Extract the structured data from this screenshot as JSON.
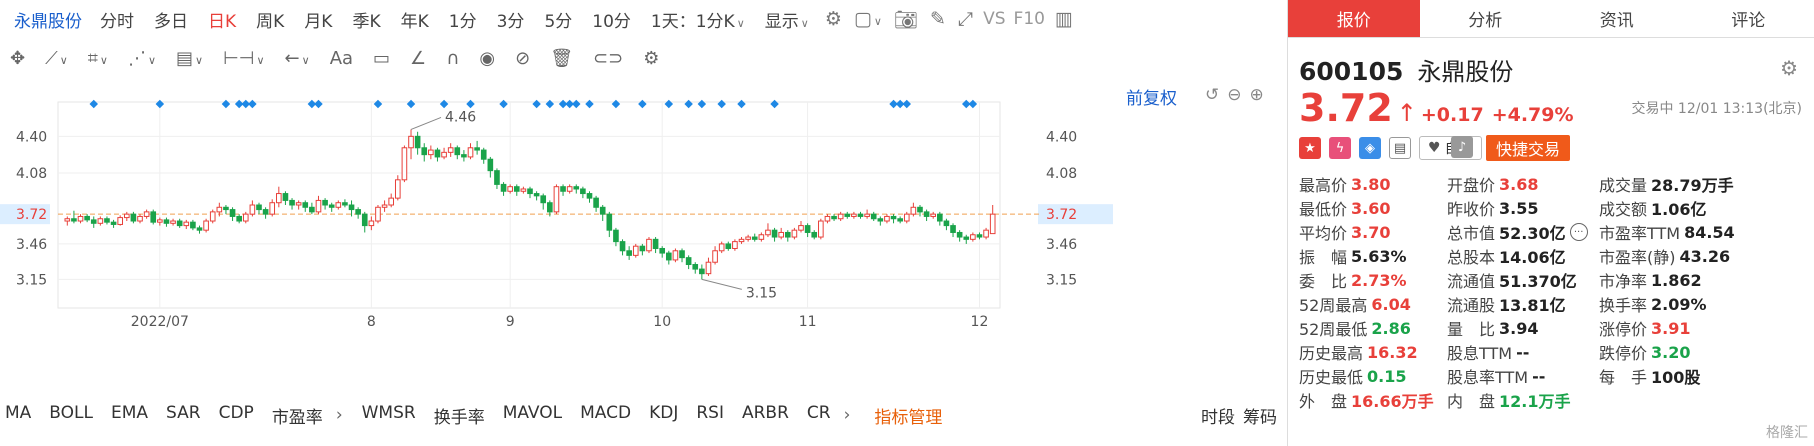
{
  "toolbar": {
    "stock_name": "永鼎股份",
    "periods": [
      {
        "label": "分时",
        "active": false
      },
      {
        "label": "多日",
        "active": false
      },
      {
        "label": "日K",
        "active": true
      },
      {
        "label": "周K",
        "active": false
      },
      {
        "label": "月K",
        "active": false
      },
      {
        "label": "季K",
        "active": false
      },
      {
        "label": "年K",
        "active": false
      },
      {
        "label": "1分",
        "active": false
      },
      {
        "label": "3分",
        "active": false
      },
      {
        "label": "5分",
        "active": false
      },
      {
        "label": "10分",
        "active": false
      }
    ],
    "interval_select": "1天：1分K",
    "display_label": "显示",
    "vs_label": "VS",
    "f10_label": "F10",
    "icons": [
      "gear-icon",
      "square-icon",
      "camera-icon",
      "pen-icon",
      "fullscreen-icon",
      "panel-icon"
    ]
  },
  "draw_tools": {
    "icons": [
      "move-icon",
      "line-icon",
      "ray-icon",
      "polyline-icon",
      "fib-icon",
      "range-icon",
      "arrow-icon",
      "text-icon",
      "comment-icon",
      "ruler-icon",
      "magnet-icon",
      "eye-icon",
      "hide-icon",
      "trash-icon",
      "link-icon",
      "settings-icon"
    ],
    "text_tool_label": "Aa"
  },
  "chart_controls": {
    "adjust_label": "前复权"
  },
  "indicators": {
    "items": [
      "MA",
      "BOLL",
      "EMA",
      "SAR",
      "CDP",
      "市盈率",
      "WMSR",
      "换手率",
      "MAVOL",
      "MACD",
      "KDJ",
      "RSI",
      "ARBR",
      "CR"
    ],
    "manage_label": "指标管理",
    "right_items": [
      "时段",
      "筹码"
    ]
  },
  "chart_data": {
    "type": "candlestick",
    "y_ticks": [
      4.4,
      4.08,
      3.72,
      3.46,
      3.15
    ],
    "x_ticks": [
      "2022/07",
      "8",
      "9",
      "10",
      "11",
      "12"
    ],
    "current_price_label": "3.72",
    "high_annotation": "4.46",
    "low_annotation": "3.15",
    "ylim": [
      2.9,
      4.7
    ],
    "colors": {
      "up": "#e8403a",
      "down": "#1aa34a",
      "current_line": "#f0a050",
      "marker": "#1e88e5"
    },
    "candles": [
      [
        3.66,
        3.68,
        3.62,
        3.7
      ],
      [
        3.68,
        3.66,
        3.64,
        3.75
      ],
      [
        3.66,
        3.7,
        3.64,
        3.72
      ],
      [
        3.7,
        3.67,
        3.65,
        3.72
      ],
      [
        3.67,
        3.64,
        3.6,
        3.7
      ],
      [
        3.64,
        3.68,
        3.62,
        3.7
      ],
      [
        3.68,
        3.65,
        3.63,
        3.7
      ],
      [
        3.65,
        3.63,
        3.6,
        3.67
      ],
      [
        3.63,
        3.69,
        3.62,
        3.71
      ],
      [
        3.69,
        3.72,
        3.66,
        3.74
      ],
      [
        3.72,
        3.66,
        3.64,
        3.74
      ],
      [
        3.66,
        3.7,
        3.64,
        3.72
      ],
      [
        3.7,
        3.74,
        3.68,
        3.76
      ],
      [
        3.74,
        3.65,
        3.63,
        3.76
      ],
      [
        3.65,
        3.67,
        3.62,
        3.69
      ],
      [
        3.67,
        3.64,
        3.61,
        3.69
      ],
      [
        3.64,
        3.66,
        3.62,
        3.68
      ],
      [
        3.66,
        3.62,
        3.6,
        3.68
      ],
      [
        3.62,
        3.65,
        3.59,
        3.67
      ],
      [
        3.65,
        3.6,
        3.58,
        3.67
      ],
      [
        3.6,
        3.58,
        3.55,
        3.62
      ],
      [
        3.58,
        3.66,
        3.56,
        3.68
      ],
      [
        3.66,
        3.74,
        3.64,
        3.76
      ],
      [
        3.74,
        3.78,
        3.7,
        3.82
      ],
      [
        3.78,
        3.76,
        3.72,
        3.8
      ],
      [
        3.76,
        3.7,
        3.66,
        3.78
      ],
      [
        3.7,
        3.66,
        3.64,
        3.72
      ],
      [
        3.66,
        3.72,
        3.64,
        3.74
      ],
      [
        3.72,
        3.8,
        3.7,
        3.84
      ],
      [
        3.8,
        3.76,
        3.72,
        3.82
      ],
      [
        3.76,
        3.72,
        3.68,
        3.78
      ],
      [
        3.72,
        3.82,
        3.7,
        3.85
      ],
      [
        3.82,
        3.9,
        3.78,
        3.96
      ],
      [
        3.9,
        3.84,
        3.8,
        3.92
      ],
      [
        3.84,
        3.8,
        3.76,
        3.86
      ],
      [
        3.8,
        3.82,
        3.76,
        3.84
      ],
      [
        3.82,
        3.78,
        3.74,
        3.84
      ],
      [
        3.78,
        3.74,
        3.72,
        3.82
      ],
      [
        3.74,
        3.84,
        3.72,
        3.88
      ],
      [
        3.84,
        3.8,
        3.76,
        3.86
      ],
      [
        3.8,
        3.78,
        3.74,
        3.82
      ],
      [
        3.78,
        3.82,
        3.76,
        3.84
      ],
      [
        3.82,
        3.8,
        3.78,
        3.85
      ],
      [
        3.8,
        3.76,
        3.7,
        3.84
      ],
      [
        3.76,
        3.72,
        3.68,
        3.78
      ],
      [
        3.72,
        3.62,
        3.56,
        3.74
      ],
      [
        3.62,
        3.66,
        3.58,
        3.7
      ],
      [
        3.66,
        3.78,
        3.64,
        3.8
      ],
      [
        3.78,
        3.8,
        3.74,
        3.84
      ],
      [
        3.8,
        3.86,
        3.78,
        3.9
      ],
      [
        3.86,
        4.02,
        3.84,
        4.06
      ],
      [
        4.02,
        4.3,
        4.0,
        4.32
      ],
      [
        4.3,
        4.4,
        4.2,
        4.46
      ],
      [
        4.4,
        4.3,
        4.24,
        4.44
      ],
      [
        4.3,
        4.24,
        4.18,
        4.34
      ],
      [
        4.24,
        4.28,
        4.2,
        4.32
      ],
      [
        4.28,
        4.22,
        4.18,
        4.3
      ],
      [
        4.22,
        4.26,
        4.2,
        4.3
      ],
      [
        4.26,
        4.3,
        4.22,
        4.34
      ],
      [
        4.3,
        4.24,
        4.2,
        4.32
      ],
      [
        4.24,
        4.22,
        4.18,
        4.28
      ],
      [
        4.22,
        4.3,
        4.2,
        4.34
      ],
      [
        4.3,
        4.28,
        4.24,
        4.36
      ],
      [
        4.28,
        4.2,
        4.16,
        4.3
      ],
      [
        4.2,
        4.1,
        4.04,
        4.22
      ],
      [
        4.1,
        3.98,
        3.94,
        4.12
      ],
      [
        3.98,
        3.92,
        3.88,
        4.0
      ],
      [
        3.92,
        3.96,
        3.9,
        3.98
      ],
      [
        3.96,
        3.92,
        3.88,
        3.98
      ],
      [
        3.92,
        3.94,
        3.9,
        3.96
      ],
      [
        3.94,
        3.9,
        3.86,
        3.96
      ],
      [
        3.9,
        3.88,
        3.84,
        3.92
      ],
      [
        3.88,
        3.82,
        3.76,
        3.9
      ],
      [
        3.82,
        3.74,
        3.7,
        3.84
      ],
      [
        3.74,
        3.96,
        3.72,
        3.98
      ],
      [
        3.96,
        3.92,
        3.88,
        3.98
      ],
      [
        3.92,
        3.96,
        3.9,
        3.98
      ],
      [
        3.96,
        3.94,
        3.9,
        3.98
      ],
      [
        3.94,
        3.9,
        3.86,
        3.96
      ],
      [
        3.9,
        3.86,
        3.82,
        3.92
      ],
      [
        3.86,
        3.78,
        3.74,
        3.88
      ],
      [
        3.78,
        3.72,
        3.66,
        3.8
      ],
      [
        3.72,
        3.58,
        3.52,
        3.74
      ],
      [
        3.58,
        3.48,
        3.44,
        3.6
      ],
      [
        3.48,
        3.4,
        3.36,
        3.5
      ],
      [
        3.4,
        3.36,
        3.32,
        3.44
      ],
      [
        3.36,
        3.44,
        3.34,
        3.46
      ],
      [
        3.44,
        3.4,
        3.36,
        3.46
      ],
      [
        3.4,
        3.5,
        3.38,
        3.52
      ],
      [
        3.5,
        3.42,
        3.38,
        3.52
      ],
      [
        3.42,
        3.38,
        3.34,
        3.44
      ],
      [
        3.38,
        3.32,
        3.28,
        3.4
      ],
      [
        3.32,
        3.4,
        3.3,
        3.42
      ],
      [
        3.4,
        3.34,
        3.3,
        3.42
      ],
      [
        3.34,
        3.28,
        3.24,
        3.36
      ],
      [
        3.28,
        3.24,
        3.2,
        3.3
      ],
      [
        3.24,
        3.2,
        3.15,
        3.28
      ],
      [
        3.2,
        3.3,
        3.18,
        3.34
      ],
      [
        3.3,
        3.4,
        3.28,
        3.44
      ],
      [
        3.4,
        3.46,
        3.38,
        3.48
      ],
      [
        3.46,
        3.42,
        3.4,
        3.48
      ],
      [
        3.42,
        3.48,
        3.4,
        3.5
      ],
      [
        3.48,
        3.5,
        3.46,
        3.52
      ],
      [
        3.5,
        3.52,
        3.48,
        3.54
      ],
      [
        3.52,
        3.5,
        3.48,
        3.55
      ],
      [
        3.5,
        3.54,
        3.48,
        3.56
      ],
      [
        3.54,
        3.58,
        3.52,
        3.64
      ],
      [
        3.58,
        3.52,
        3.48,
        3.6
      ],
      [
        3.52,
        3.56,
        3.5,
        3.6
      ],
      [
        3.56,
        3.52,
        3.48,
        3.58
      ],
      [
        3.52,
        3.58,
        3.5,
        3.6
      ],
      [
        3.58,
        3.62,
        3.56,
        3.66
      ],
      [
        3.62,
        3.56,
        3.52,
        3.64
      ],
      [
        3.56,
        3.52,
        3.5,
        3.58
      ],
      [
        3.52,
        3.66,
        3.5,
        3.68
      ],
      [
        3.66,
        3.7,
        3.64,
        3.72
      ],
      [
        3.7,
        3.68,
        3.66,
        3.72
      ],
      [
        3.68,
        3.72,
        3.66,
        3.74
      ],
      [
        3.72,
        3.7,
        3.68,
        3.74
      ],
      [
        3.7,
        3.72,
        3.68,
        3.74
      ],
      [
        3.72,
        3.7,
        3.68,
        3.74
      ],
      [
        3.7,
        3.72,
        3.68,
        3.76
      ],
      [
        3.72,
        3.68,
        3.66,
        3.74
      ],
      [
        3.68,
        3.66,
        3.62,
        3.7
      ],
      [
        3.66,
        3.7,
        3.64,
        3.72
      ],
      [
        3.7,
        3.68,
        3.64,
        3.72
      ],
      [
        3.68,
        3.66,
        3.64,
        3.7
      ],
      [
        3.66,
        3.72,
        3.64,
        3.74
      ],
      [
        3.72,
        3.78,
        3.7,
        3.82
      ],
      [
        3.78,
        3.74,
        3.7,
        3.8
      ],
      [
        3.74,
        3.7,
        3.66,
        3.76
      ],
      [
        3.7,
        3.72,
        3.68,
        3.74
      ],
      [
        3.72,
        3.66,
        3.62,
        3.74
      ],
      [
        3.66,
        3.62,
        3.58,
        3.68
      ],
      [
        3.62,
        3.56,
        3.52,
        3.64
      ],
      [
        3.56,
        3.52,
        3.48,
        3.58
      ],
      [
        3.52,
        3.5,
        3.46,
        3.54
      ],
      [
        3.5,
        3.54,
        3.48,
        3.56
      ],
      [
        3.54,
        3.52,
        3.5,
        3.56
      ],
      [
        3.52,
        3.58,
        3.5,
        3.6
      ],
      [
        3.55,
        3.72,
        3.6,
        3.8
      ]
    ],
    "markers_at": [
      3,
      10,
      18,
      19,
      20,
      21,
      27,
      28,
      35,
      38,
      42,
      45,
      49,
      52,
      54,
      55,
      56,
      57,
      58,
      61,
      64,
      67,
      69,
      71,
      73,
      75,
      79,
      92,
      93,
      94,
      100,
      101
    ]
  },
  "quote": {
    "tabs": [
      {
        "label": "报价",
        "active": true
      },
      {
        "label": "分析",
        "active": false
      },
      {
        "label": "资讯",
        "active": false
      },
      {
        "label": "评论",
        "active": false
      }
    ],
    "code": "600105",
    "name": "永鼎股份",
    "price": "3.72",
    "arrow": "↑",
    "change": "+0.17",
    "change_pct": "+4.79%",
    "status": "交易中 12/01 13:13(北京)",
    "watch_label": "自选",
    "trade_label": "快捷交易",
    "rows": [
      [
        {
          "l": "最高价",
          "v": "3.80",
          "c": "red"
        },
        {
          "l": "开盘价",
          "v": "3.68",
          "c": "red"
        },
        {
          "l": "成交量",
          "v": "28.79万手",
          "c": "dark"
        }
      ],
      [
        {
          "l": "最低价",
          "v": "3.60",
          "c": "red"
        },
        {
          "l": "昨收价",
          "v": "3.55",
          "c": "dark"
        },
        {
          "l": "成交额",
          "v": "1.06亿",
          "c": "dark"
        }
      ],
      [
        {
          "l": "平均价",
          "v": "3.70",
          "c": "red"
        },
        {
          "l": "总市值",
          "v": "52.30亿",
          "c": "dark"
        },
        {
          "l": "市盈率TTM",
          "v": "84.54",
          "c": "dark"
        }
      ],
      [
        {
          "l": "振　幅",
          "v": "5.63%",
          "c": "dark"
        },
        {
          "l": "总股本",
          "v": "14.06亿",
          "c": "dark"
        },
        {
          "l": "市盈率(静)",
          "v": "43.26",
          "c": "dark"
        }
      ],
      [
        {
          "l": "委　比",
          "v": "2.73%",
          "c": "red"
        },
        {
          "l": "流通值",
          "v": "51.370亿",
          "c": "dark"
        },
        {
          "l": "市净率",
          "v": "1.862",
          "c": "dark"
        }
      ],
      [
        {
          "l": "52周最高",
          "v": "6.04",
          "c": "red"
        },
        {
          "l": "流通股",
          "v": "13.81亿",
          "c": "dark"
        },
        {
          "l": "换手率",
          "v": "2.09%",
          "c": "dark"
        }
      ],
      [
        {
          "l": "52周最低",
          "v": "2.86",
          "c": "green"
        },
        {
          "l": "量　比",
          "v": "3.94",
          "c": "dark"
        },
        {
          "l": "涨停价",
          "v": "3.91",
          "c": "red"
        }
      ],
      [
        {
          "l": "历史最高",
          "v": "16.32",
          "c": "red"
        },
        {
          "l": "股息TTM",
          "v": "--",
          "c": "dark"
        },
        {
          "l": "跌停价",
          "v": "3.20",
          "c": "green"
        }
      ],
      [
        {
          "l": "历史最低",
          "v": "0.15",
          "c": "green"
        },
        {
          "l": "股息率TTM",
          "v": "--",
          "c": "dark"
        },
        {
          "l": "每　手",
          "v": "100股",
          "c": "dark"
        }
      ],
      [
        {
          "l": "外　盘",
          "v": "16.66万手",
          "c": "red"
        },
        {
          "l": "内　盘",
          "v": "12.1万手",
          "c": "green"
        },
        {
          "l": "",
          "v": "",
          "c": "dark"
        }
      ]
    ],
    "watermark": "格隆汇"
  }
}
